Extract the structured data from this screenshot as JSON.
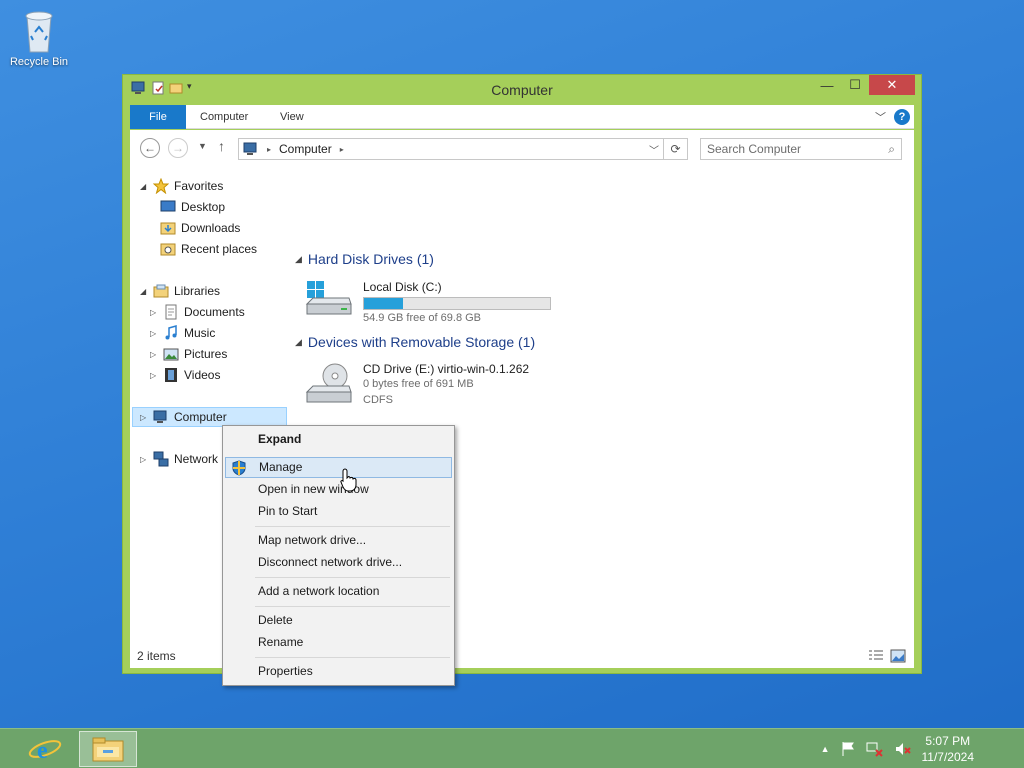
{
  "desktop": {
    "recycle_bin_label": "Recycle Bin"
  },
  "window": {
    "title": "Computer",
    "controls": {
      "minimize": "—",
      "maximize": "☐",
      "close": "✕"
    },
    "ribbon_tabs": [
      "File",
      "Computer",
      "View"
    ],
    "help_label": "?",
    "address": {
      "crumb": "Computer"
    },
    "search_placeholder": "Search Computer",
    "nav": {
      "favorites": "Favorites",
      "favorites_items": [
        "Desktop",
        "Downloads",
        "Recent places"
      ],
      "libraries": "Libraries",
      "library_items": [
        "Documents",
        "Music",
        "Pictures",
        "Videos"
      ],
      "computer": "Computer",
      "network": "Network"
    },
    "groups": {
      "hard_disks": {
        "header": "Hard Disk Drives (1)",
        "drive_name": "Local Disk (C:)",
        "free_text": "54.9 GB free of 69.8 GB",
        "used_fraction": 0.21
      },
      "removable": {
        "header": "Devices with Removable Storage (1)",
        "drive_name": "CD Drive (E:) virtio-win-0.1.262",
        "free_text": "0 bytes free of 691 MB",
        "fs_text": "CDFS"
      }
    },
    "status": "2 items"
  },
  "context_menu": {
    "items": [
      "Expand",
      "Manage",
      "Open in new window",
      "Pin to Start",
      "Map network drive...",
      "Disconnect network drive...",
      "Add a network location",
      "Delete",
      "Rename",
      "Properties"
    ]
  },
  "taskbar": {
    "time": "5:07 PM",
    "date": "11/7/2024"
  },
  "colors": {
    "accent": "#1979ca",
    "window_frame": "#a5cf5a",
    "close": "#c7484a",
    "progress": "#26a0da"
  }
}
